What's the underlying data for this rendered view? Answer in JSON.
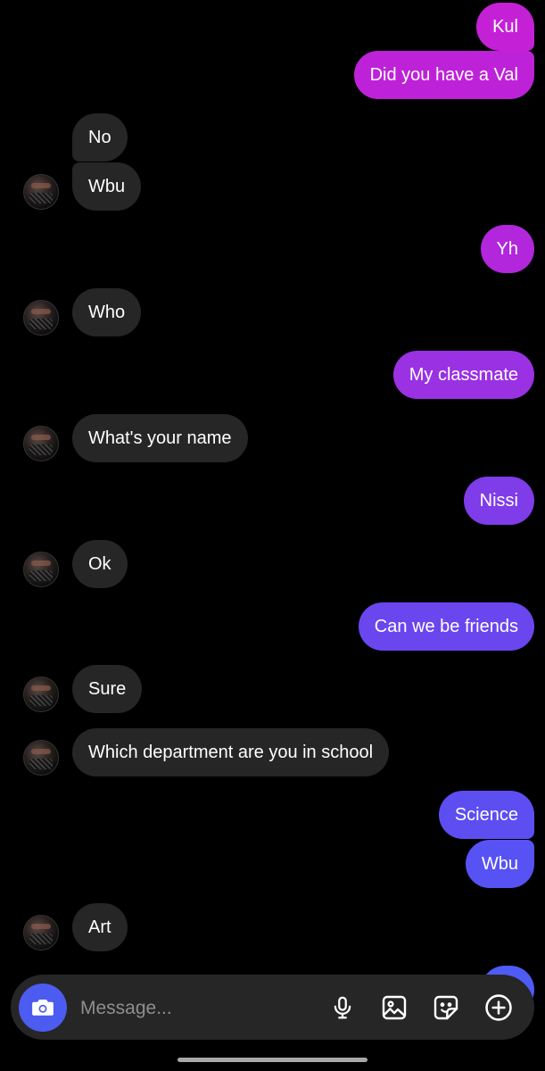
{
  "messages": [
    {
      "text": "Kul",
      "dir": "sent",
      "color": "#c421d6"
    },
    {
      "text": "Did you have a Val",
      "dir": "sent",
      "color": "#be22d8"
    },
    {
      "text": "No",
      "dir": "received"
    },
    {
      "text": "Wbu",
      "dir": "received"
    },
    {
      "text": "Yh",
      "dir": "sent",
      "color": "#b226dc"
    },
    {
      "text": "Who",
      "dir": "received"
    },
    {
      "text": "My classmate",
      "dir": "sent",
      "color": "#9a31e3"
    },
    {
      "text": "What's your name",
      "dir": "received"
    },
    {
      "text": "Nissi",
      "dir": "sent",
      "color": "#7f3ce9"
    },
    {
      "text": "Ok",
      "dir": "received"
    },
    {
      "text": "Can we be friends",
      "dir": "sent",
      "color": "#6a46ef"
    },
    {
      "text": "Sure",
      "dir": "received"
    },
    {
      "text": "Which department are you in school",
      "dir": "received"
    },
    {
      "text": "Science",
      "dir": "sent",
      "color": "#5d4ef2"
    },
    {
      "text": "Wbu",
      "dir": "sent",
      "color": "#5652f4"
    },
    {
      "text": "Art",
      "dir": "received"
    }
  ],
  "composer": {
    "placeholder": "Message...",
    "icons": [
      "camera-icon",
      "microphone-icon",
      "gallery-icon",
      "sticker-icon",
      "plus-icon"
    ]
  },
  "colors": {
    "background": "#000000",
    "received_bubble": "#262626",
    "accent": "#4c5bf0"
  }
}
